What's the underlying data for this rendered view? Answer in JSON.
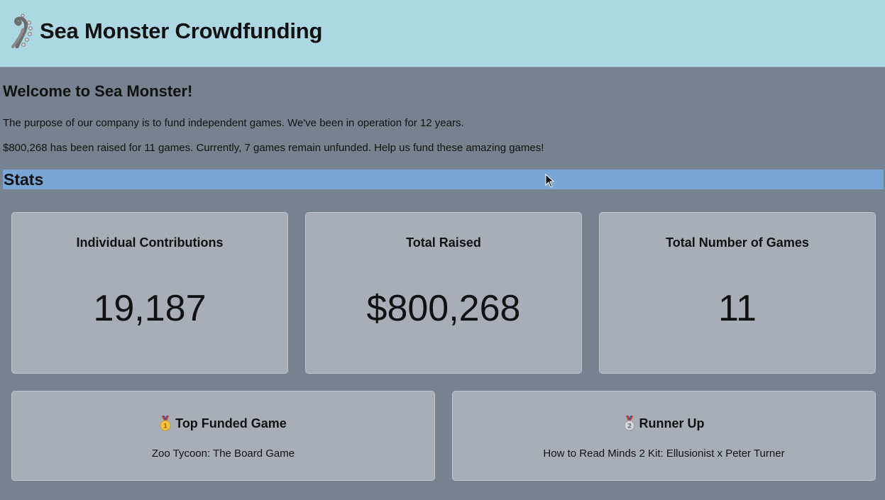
{
  "header": {
    "title": "Sea Monster Crowdfunding",
    "logo_icon": "tentacle-icon",
    "background": "#acd8e3"
  },
  "intro": {
    "heading": "Welcome to Sea Monster!",
    "line1": "The purpose of our company is to fund independent games. We've been in operation for 12 years.",
    "line2": "$800,268 has been raised for 11 games. Currently, 7 games remain unfunded. Help us fund these amazing games!"
  },
  "stats": {
    "heading": "Stats",
    "bar_color": "#7aa6d6",
    "cards": [
      {
        "label": "Individual Contributions",
        "value": "19,187"
      },
      {
        "label": "Total Raised",
        "value": "$800,268"
      },
      {
        "label": "Total Number of Games",
        "value": "11"
      }
    ]
  },
  "games": {
    "top": {
      "icon": "gold-medal-icon",
      "title": "Top Funded Game",
      "name": "Zoo Tycoon: The Board Game"
    },
    "runner_up": {
      "icon": "silver-medal-icon",
      "title": "Runner Up",
      "name": "How to Read Minds 2 Kit: Ellusionist x Peter Turner"
    }
  },
  "colors": {
    "page_background": "#76828f",
    "card_background": "#a8aeb8"
  }
}
